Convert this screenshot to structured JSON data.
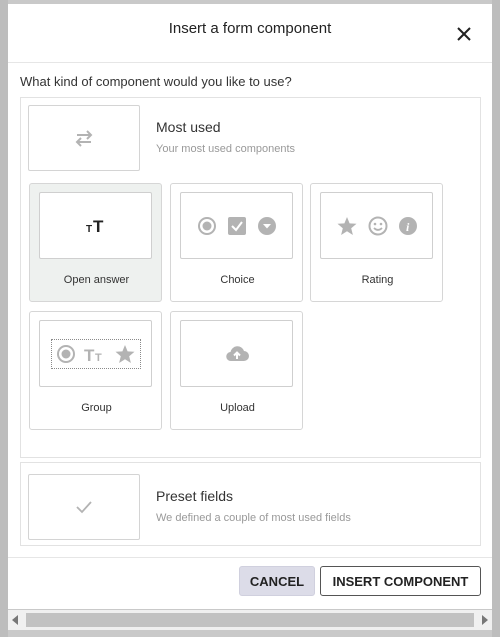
{
  "dialog": {
    "title": "Insert a form component",
    "question": "What kind of component would you like to use?"
  },
  "most_used": {
    "title": "Most used",
    "subtitle": "Your most used components",
    "icon": "swap-arrows-icon"
  },
  "components": [
    {
      "label": "Open answer",
      "icon": "text-size-icon",
      "selected": true
    },
    {
      "label": "Choice",
      "icons": [
        "radio-icon",
        "checkbox-icon",
        "dropdown-icon"
      ]
    },
    {
      "label": "Rating",
      "icons": [
        "star-icon",
        "smiley-icon",
        "info-icon"
      ]
    },
    {
      "label": "Group",
      "icons": [
        "radio-icon",
        "text-size-icon",
        "star-icon"
      ]
    },
    {
      "label": "Upload",
      "icon": "cloud-upload-icon"
    }
  ],
  "preset": {
    "title": "Preset fields",
    "subtitle": "We defined a couple of most used fields",
    "icon": "checkmark-icon"
  },
  "footer": {
    "cancel_label": "CANCEL",
    "insert_label": "INSERT COMPONENT"
  },
  "colors": {
    "icon_gray": "#b3b3b3",
    "selected_bg": "#eef1ef",
    "cancel_bg": "#dcdce8"
  }
}
